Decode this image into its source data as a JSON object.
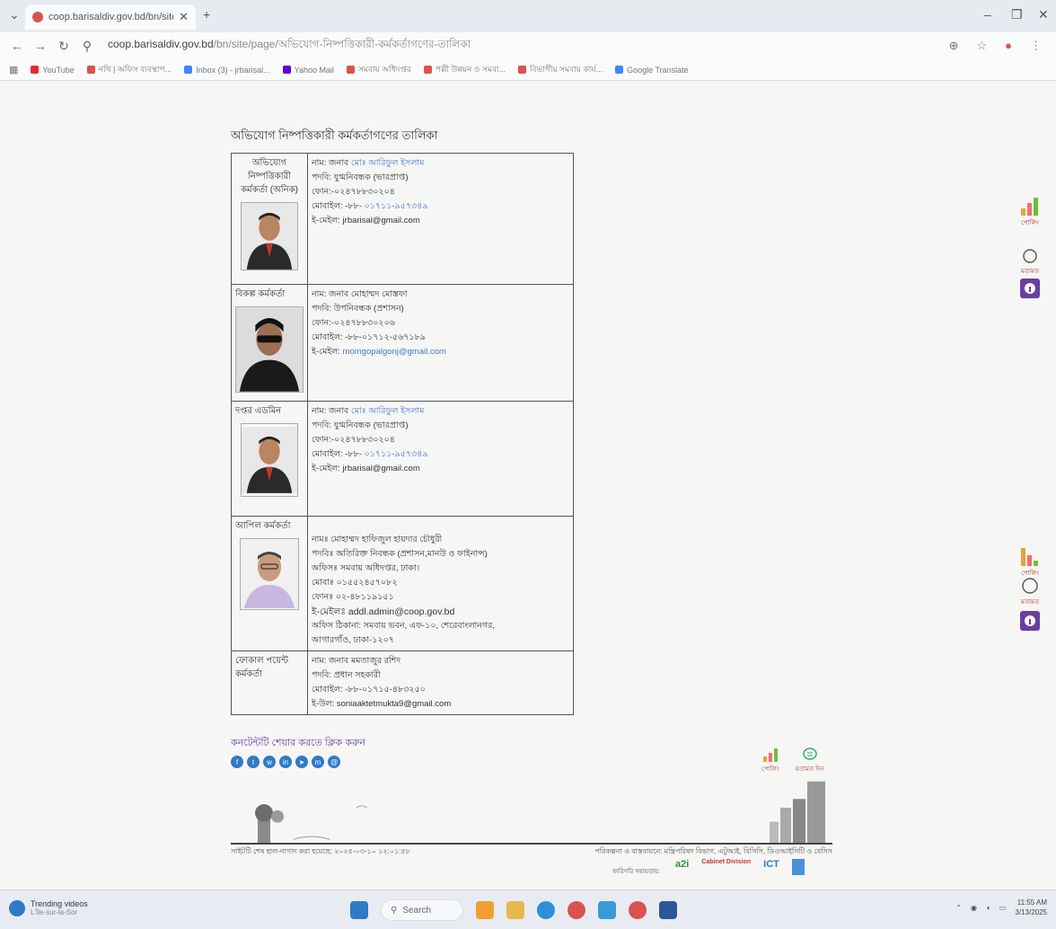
{
  "browser": {
    "tab_title": "coop.barisaldiv.gov.bd/bn/site",
    "url_host": "coop.barisaldiv.gov.bd",
    "url_path": "/bn/site/page/অভিযোগ-নিষ্পত্তিকারী-কর্মকর্তাগণের-তালিকা",
    "bookmarks": [
      {
        "label": "YouTube",
        "color": "#e52d27"
      },
      {
        "label": "নথি | অফিস ব্যবস্থাপ...",
        "color": "#d9534f"
      },
      {
        "label": "Inbox (3) - jrbarisal...",
        "color": "#4285f4"
      },
      {
        "label": "Yahoo Mail",
        "color": "#6001d2"
      },
      {
        "label": "সমবায় অধিদপ্তর",
        "color": "#d9534f"
      },
      {
        "label": "পল্লী উন্নয়ন ও সমবা...",
        "color": "#d9534f"
      },
      {
        "label": "বিভাগীয় সমবায় কার্য...",
        "color": "#d9534f"
      },
      {
        "label": "Google Translate",
        "color": "#4285f4"
      }
    ]
  },
  "page": {
    "heading": "অভিযোগ নিষ্পত্তিকারী কর্মকর্তাগণের তালিকা",
    "officers": [
      {
        "role": [
          "অভিযোগ",
          "নিষ্পত্তিকারী",
          "কর্মকর্তা (অনিক)"
        ],
        "name_prefix": "নাম: জনাব ",
        "name_link": "মোঃ আরিফুল ইসলাম",
        "lines": [
          "পদবি: যুগ্মনিবন্ধক (ভারপ্রাপ্ত)",
          "ফোন:-০২৪৭৮৮৩০২০৪"
        ],
        "mobile_prefix": "মোবাইল: -৮৮- ",
        "mobile_link": "০১৭১১-৯৫৭৩৪৯",
        "email_prefix": "ই-মেইল: ",
        "email": "jrbarisal@gmail.com"
      },
      {
        "role": [
          "বিকল্প কর্মকর্তা"
        ],
        "name_prefix": "নাম: জনাব মোহাম্মদ মোস্তফা",
        "lines": [
          "পদবি: উপনিবন্ধক (প্রশাসন)",
          "ফোন:-০২৪৭৮৮৩০২০৬",
          "মোবাইল: -৮৮-০১৭১২-৫৬৭১৮৯"
        ],
        "email_prefix": "ই-মেইল: ",
        "email": "momgopalgonj@gmail.com"
      },
      {
        "role": [
          "দপ্তর এডমিন"
        ],
        "name_prefix": "নাম: জনাব ",
        "name_link": "মোঃ আরিফুল ইসলাম",
        "lines": [
          "পদবি: যুগ্মনিবন্ধক (ভারপ্রাপ্ত)",
          "ফোন:-০২৪৭৮৮৩০২০৪"
        ],
        "mobile_prefix": "মোবাইল: -৮৮- ",
        "mobile_link": "০১৭১১-৯৫৭৩৪৯",
        "email_prefix": "ই-মেইল: ",
        "email": "jrbarisal@gmail.com"
      },
      {
        "role": [
          "আপিল কর্মকর্তা"
        ],
        "lines": [
          "নামঃ মোহাম্মদ হাফিজুল হায়দার চৌধুরী",
          "পদবিঃ অতিরিক্ত নিবন্ধক (প্রশাসন,মানউ ও ফাইনান্স)",
          "অফিসঃ সমবায় অধিদপ্তর, ঢাকা।",
          "মোবাঃ ০১৫৫২৪৫৭০৮২",
          "ফোনঃ ০২-৪৮১১৯১৫১",
          "ই-মেইলঃ addl.admin@coop.gov.bd",
          "অফিস ঠিকানা: সমবায় ভবন, এফ-১০, শেরেবাংলানগর,",
          "আগারগাঁও, ঢাকা-১২০৭"
        ]
      },
      {
        "role": [
          "ফোকাল পয়েন্ট",
          "কর্মকর্তা"
        ],
        "lines": [
          "নাম: জনাব মমতাজুর রশিদ",
          "পদবি: প্রধান সহকারী",
          "মোবাইল: -৮৮-০১৭১৫-৪৮৩২৫০",
          "ই-উল: soniaaktetmukta9@gmail.com"
        ]
      }
    ],
    "share_title": "কনটেন্টটি শেয়ার করতে ক্লিক করুন",
    "poll_label": "পোলিং",
    "opinion_label": "মতামত দিন",
    "last_updated": "সাইটটি শেষ হাল-নাগাদ করা হয়েছে: ২০২৫-০৩-১০ ১২:০১:৫৮",
    "planning": "পরিকল্পনা ও বাস্তবায়নে: মন্ত্রিপরিষদ বিভাগ, এটুআই, বিসিসি, ডিওআইসিটি ও বেসিস",
    "tech_support": "কারিগরি সহায়তায়:",
    "logos": [
      "a2i",
      "Cabinet Division",
      "ICT"
    ]
  },
  "side": {
    "poll": "পোলিং",
    "opinion": "মতামত"
  },
  "taskbar": {
    "trending_title": "Trending videos",
    "trending_sub": "L'Île-sur-la-Sor",
    "search": "Search",
    "time": "11:55 AM",
    "date": "3/13/2025"
  },
  "colors": {
    "link": "#4a76c8",
    "share": "#6a3fa0",
    "accent_red": "#d9534f",
    "share_icon": "#2f7ac6"
  }
}
